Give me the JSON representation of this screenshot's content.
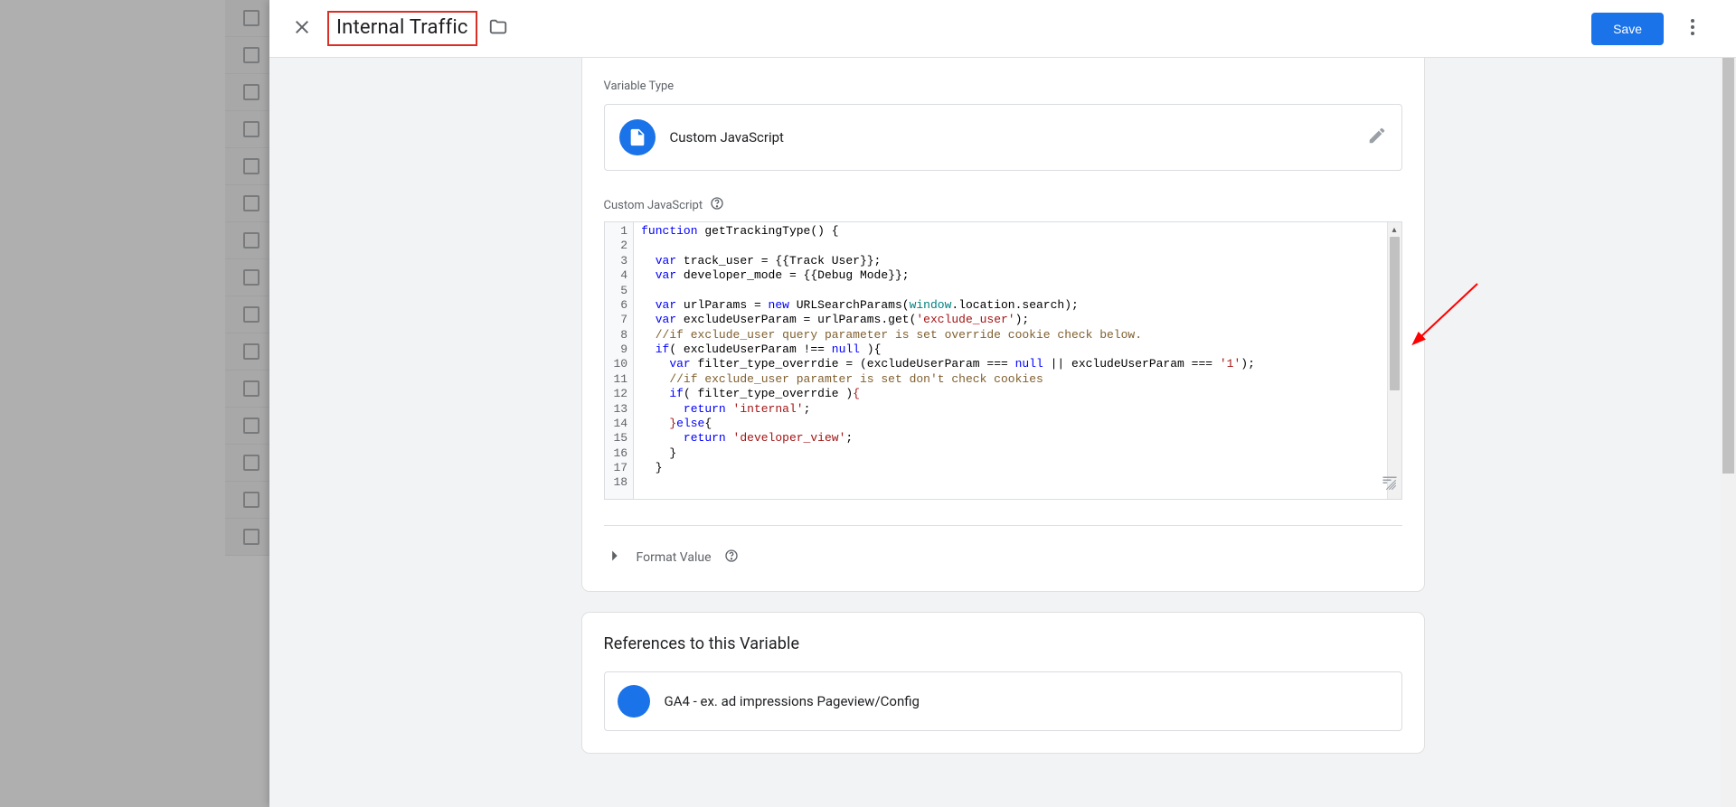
{
  "header": {
    "title": "Internal Traffic",
    "save_label": "Save"
  },
  "config": {
    "variable_type_label": "Variable Type",
    "variable_type_name": "Custom JavaScript",
    "code_section_label": "Custom JavaScript",
    "format_value_label": "Format Value"
  },
  "code_lines": [
    [
      [
        "function",
        "c-blue"
      ],
      [
        " ",
        "c-black"
      ],
      [
        "getTrackingType",
        "c-black"
      ],
      [
        "() {",
        "c-black"
      ]
    ],
    [
      [
        "",
        "c-black"
      ]
    ],
    [
      [
        "  ",
        "c-black"
      ],
      [
        "var",
        "c-blue"
      ],
      [
        " track_user = {{Track User}};",
        "c-black"
      ]
    ],
    [
      [
        "  ",
        "c-black"
      ],
      [
        "var",
        "c-blue"
      ],
      [
        " developer_mode = {{Debug Mode}};",
        "c-black"
      ]
    ],
    [
      [
        "",
        "c-black"
      ]
    ],
    [
      [
        "  ",
        "c-black"
      ],
      [
        "var",
        "c-blue"
      ],
      [
        " urlParams = ",
        "c-black"
      ],
      [
        "new",
        "c-blue"
      ],
      [
        " URLSearchParams(",
        "c-black"
      ],
      [
        "window",
        "c-teal"
      ],
      [
        ".location.search);",
        "c-black"
      ]
    ],
    [
      [
        "  ",
        "c-black"
      ],
      [
        "var",
        "c-blue"
      ],
      [
        " excludeUserParam = urlParams.get(",
        "c-black"
      ],
      [
        "'exclude_user'",
        "c-red"
      ],
      [
        ");",
        "c-black"
      ]
    ],
    [
      [
        "  ",
        "c-black"
      ],
      [
        "//if exclude_user query parameter is set override cookie check below.",
        "c-brown"
      ]
    ],
    [
      [
        "  ",
        "c-black"
      ],
      [
        "if",
        "c-blue"
      ],
      [
        "( excludeUserParam !== ",
        "c-black"
      ],
      [
        "null",
        "c-blue"
      ],
      [
        " ){",
        "c-black"
      ]
    ],
    [
      [
        "    ",
        "c-black"
      ],
      [
        "var",
        "c-blue"
      ],
      [
        " filter_type_overrdie = (excludeUserParam === ",
        "c-black"
      ],
      [
        "null",
        "c-blue"
      ],
      [
        " || excludeUserParam === ",
        "c-black"
      ],
      [
        "'1'",
        "c-red"
      ],
      [
        ");",
        "c-black"
      ]
    ],
    [
      [
        "    ",
        "c-black"
      ],
      [
        "//if exclude_user paramter is set don't check cookies",
        "c-brown"
      ]
    ],
    [
      [
        "    ",
        "c-black"
      ],
      [
        "if",
        "c-blue"
      ],
      [
        "( filter_type_overrdie )",
        "c-black"
      ],
      [
        "{",
        "c-red"
      ]
    ],
    [
      [
        "      ",
        "c-black"
      ],
      [
        "return",
        "c-blue"
      ],
      [
        " ",
        "c-black"
      ],
      [
        "'internal'",
        "c-red"
      ],
      [
        ";",
        "c-black"
      ]
    ],
    [
      [
        "    ",
        "c-black"
      ],
      [
        "}",
        "c-red"
      ],
      [
        "else",
        "c-blue"
      ],
      [
        "{",
        "c-black"
      ]
    ],
    [
      [
        "      ",
        "c-black"
      ],
      [
        "return",
        "c-blue"
      ],
      [
        " ",
        "c-black"
      ],
      [
        "'developer_view'",
        "c-red"
      ],
      [
        ";",
        "c-black"
      ]
    ],
    [
      [
        "    }",
        "c-black"
      ]
    ],
    [
      [
        "  }",
        "c-black"
      ]
    ],
    [
      [
        "",
        "c-black"
      ]
    ]
  ],
  "references": {
    "title": "References to this Variable",
    "items": [
      {
        "label": "GA4 - ex. ad impressions Pageview/Config"
      }
    ]
  }
}
